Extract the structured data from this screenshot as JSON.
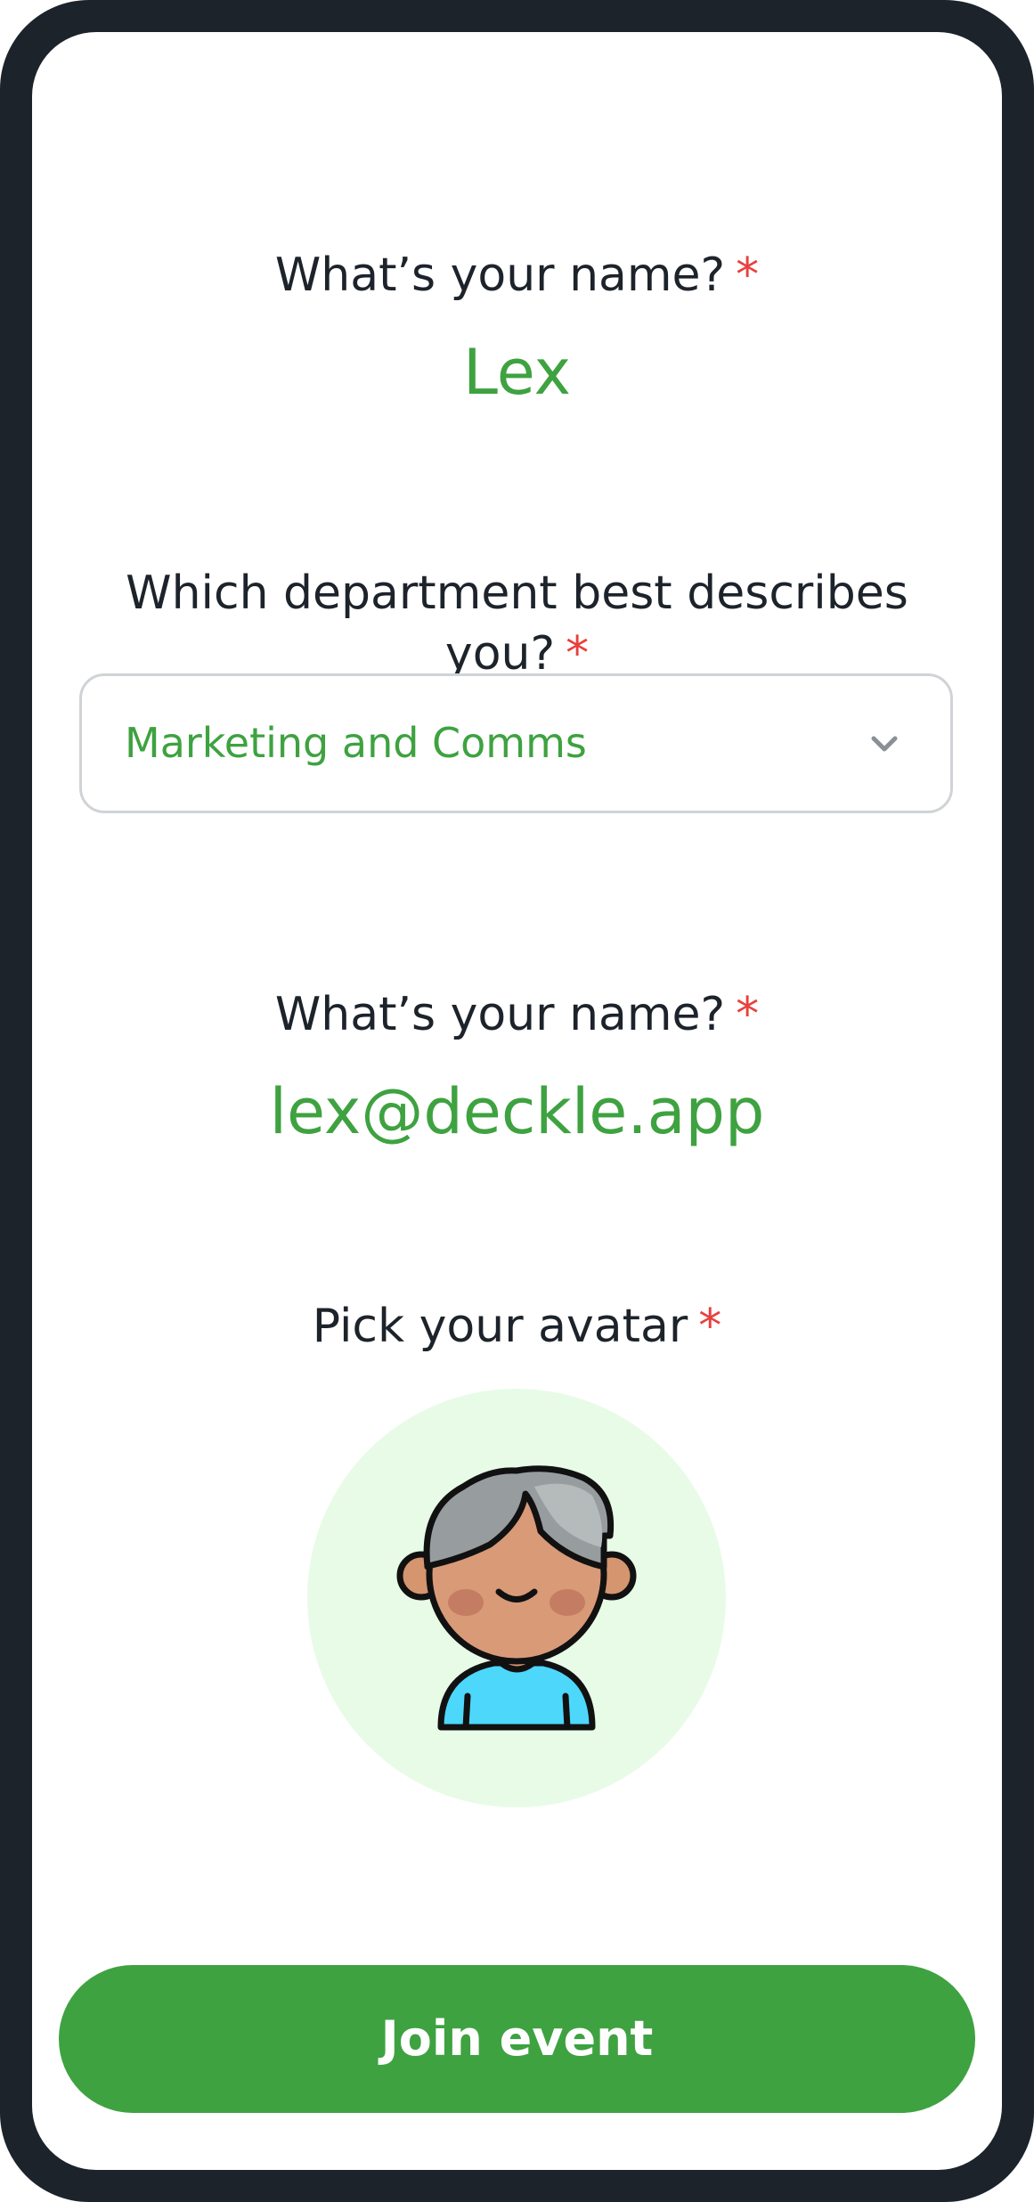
{
  "form": {
    "name_question": "What’s your name?",
    "name_value": "Lex",
    "department_question": "Which department best describes you?",
    "department_value": "Marketing and Comms",
    "email_question": "What’s your name?",
    "email_value": "lex@deckle.app",
    "avatar_question": "Pick your avatar",
    "required_marker": "*"
  },
  "actions": {
    "join_label": "Join event"
  },
  "icons": {
    "dropdown": "chevron-down-icon",
    "avatar": "boy-avatar-icon"
  },
  "colors": {
    "accent": "#3ea240",
    "required": "#e8403d",
    "text": "#1d232b",
    "avatar_bg": "#e8fbe7",
    "frame": "#1c232b"
  }
}
